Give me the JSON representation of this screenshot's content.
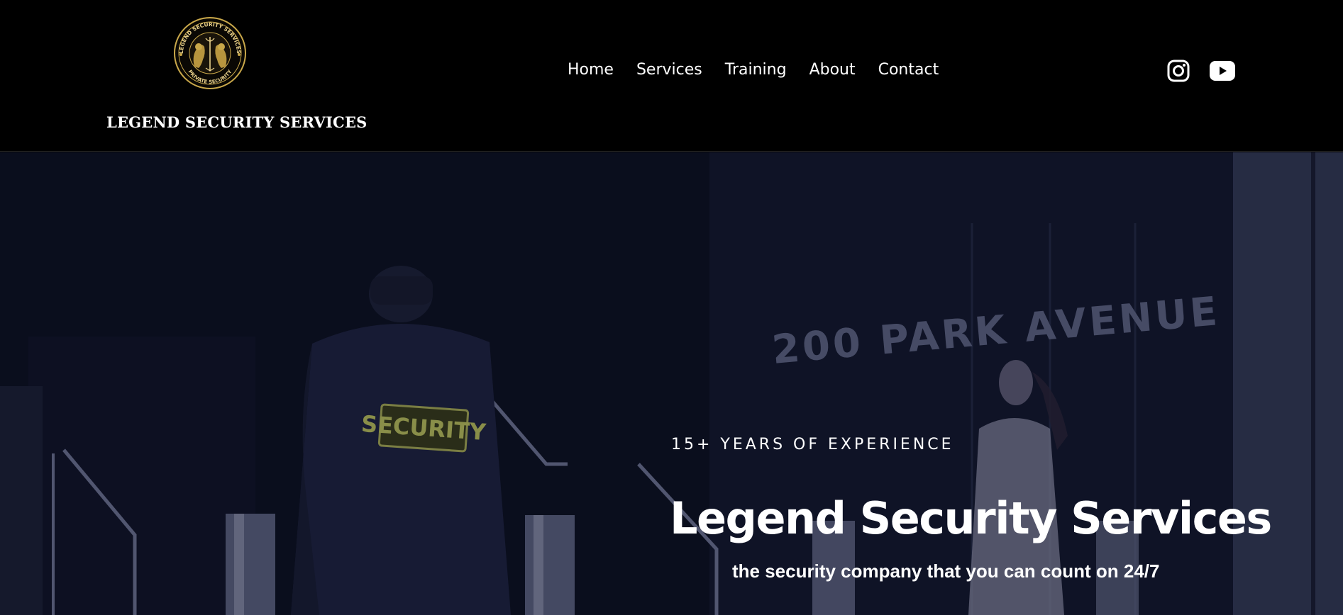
{
  "header": {
    "logo_alt_icon": "legend-security-logo-icon",
    "logo": {
      "ring_top_text": "LEGEND SECURITY SERVICES",
      "ring_bottom_text": "PRIVATE SECURITY"
    },
    "brand_name": "LEGEND SECURITY SERVICES",
    "nav": [
      {
        "label": "Home"
      },
      {
        "label": "Services"
      },
      {
        "label": "Training"
      },
      {
        "label": "About"
      },
      {
        "label": "Contact"
      }
    ],
    "socials": [
      {
        "name": "instagram-icon"
      },
      {
        "name": "youtube-icon"
      }
    ]
  },
  "hero": {
    "eyebrow": "15+ YEARS OF EXPERIENCE",
    "title": "Legend Security Services",
    "subtitle": "the security company that you can count on 24/7",
    "background_text": "200 PARK AVENUE",
    "jacket_text": "SECURITY"
  },
  "colors": {
    "header_bg": "#000000",
    "hero_bg": "#10132a",
    "text": "#ffffff",
    "logo_gold": "#c9a84a"
  }
}
